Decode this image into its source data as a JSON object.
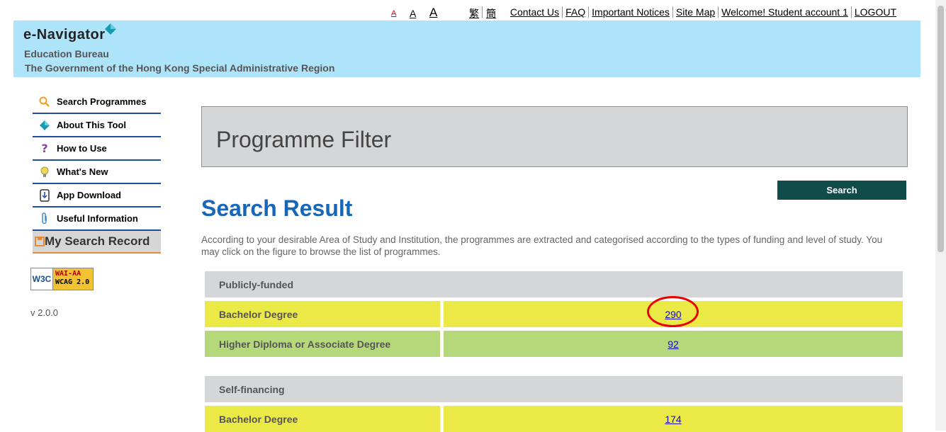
{
  "topbar": {
    "font_sizes": [
      "A",
      "A",
      "A"
    ],
    "lang_tc": "繁",
    "lang_sc": "簡",
    "links": [
      "Contact Us",
      "FAQ",
      "Important Notices",
      "Site Map",
      "Welcome! Student account 1",
      "LOGOUT"
    ]
  },
  "header": {
    "logo_text": "e-Navigator",
    "org_line1": "Education Bureau",
    "org_line2": "The Government of the Hong Kong Special Administrative Region"
  },
  "sidebar": {
    "items": [
      {
        "label": "Search Programmes",
        "icon": "search-icon"
      },
      {
        "label": "About This Tool",
        "icon": "navigator-icon"
      },
      {
        "label": "How to Use",
        "icon": "question-icon"
      },
      {
        "label": "What's New",
        "icon": "lightbulb-icon"
      },
      {
        "label": "App Download",
        "icon": "download-icon"
      },
      {
        "label": "Useful Information",
        "icon": "paperclip-icon"
      }
    ],
    "my_record": "My Search Record",
    "badge_left": "W3C",
    "badge_right_1": "WAI-AA",
    "badge_right_2": "WCAG 2.0",
    "version": "v 2.0.0"
  },
  "main": {
    "filter_title": "Programme Filter",
    "search_button": "Search",
    "result_title": "Search Result",
    "description": "According to your desirable Area of Study and Institution, the programmes are extracted and categorised according to the types of funding and level of study. You may click on the figure to browse the list of programmes.",
    "sections": [
      {
        "title": "Publicly-funded",
        "rows": [
          {
            "label": "Bachelor Degree",
            "count": "290"
          },
          {
            "label": "Higher Diploma or Associate Degree",
            "count": "92"
          }
        ]
      },
      {
        "title": "Self-financing",
        "rows": [
          {
            "label": "Bachelor Degree",
            "count": "174"
          }
        ]
      }
    ]
  },
  "colors": {
    "header_bg": "#aee4fa",
    "accent_blue": "#1866b8",
    "search_button": "#0f4c4a",
    "row_yellow": "#ebe945",
    "row_green": "#b5d97a",
    "row_grey": "#d5d6d8",
    "highlight_circle": "#e00000"
  }
}
